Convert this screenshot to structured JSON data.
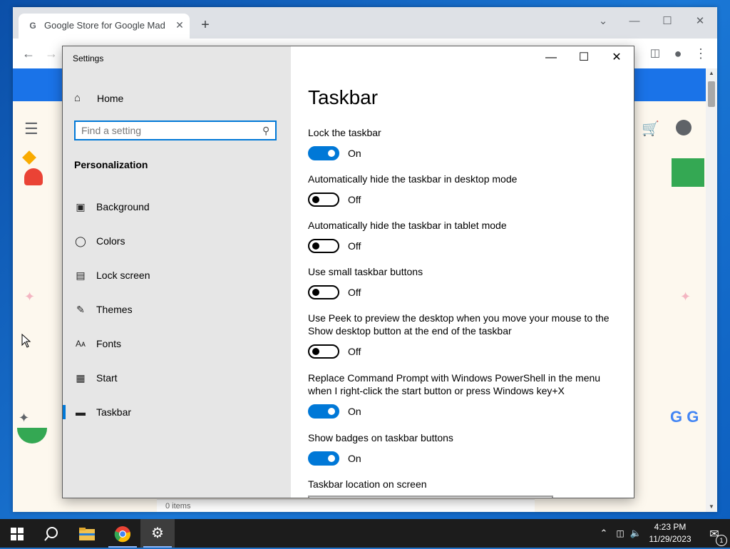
{
  "chrome": {
    "tab_title": "Google Store for Google Made D",
    "tab_favicon": "G",
    "new_tab": "+",
    "close_tab": "✕",
    "minimize": "—",
    "maximize": "☐",
    "close": "✕",
    "dropdown": "⌄",
    "status_fragment": "0 items"
  },
  "settings": {
    "app_title": "Settings",
    "home_label": "Home",
    "search_placeholder": "Find a setting",
    "search_value": "",
    "section_title": "Personalization",
    "nav_items": [
      {
        "label": "Background",
        "icon": "picture-icon"
      },
      {
        "label": "Colors",
        "icon": "palette-icon"
      },
      {
        "label": "Lock screen",
        "icon": "monitor-icon"
      },
      {
        "label": "Themes",
        "icon": "brush-icon"
      },
      {
        "label": "Fonts",
        "icon": "font-icon"
      },
      {
        "label": "Start",
        "icon": "start-tiles-icon"
      },
      {
        "label": "Taskbar",
        "icon": "taskbar-icon"
      }
    ],
    "active_item": "Taskbar",
    "window": {
      "minimize": "—",
      "maximize": "☐",
      "close": "✕"
    },
    "page_title": "Taskbar",
    "options": [
      {
        "label": "Lock the taskbar",
        "state": "On"
      },
      {
        "label": "Automatically hide the taskbar in desktop mode",
        "state": "Off"
      },
      {
        "label": "Automatically hide the taskbar in tablet mode",
        "state": "Off"
      },
      {
        "label": "Use small taskbar buttons",
        "state": "Off"
      },
      {
        "label": "Use Peek to preview the desktop when you move your mouse to the Show desktop button at the end of the taskbar",
        "state": "Off"
      },
      {
        "label": "Replace Command Prompt with Windows PowerShell in the menu when I right-click the start button or press Windows key+X",
        "state": "On"
      },
      {
        "label": "Show badges on taskbar buttons",
        "state": "On"
      }
    ],
    "location_label": "Taskbar location on screen",
    "accent_color": "#0078d7"
  },
  "taskbar": {
    "time": "4:23 PM",
    "date": "11/29/2023",
    "notification_count": "1"
  }
}
